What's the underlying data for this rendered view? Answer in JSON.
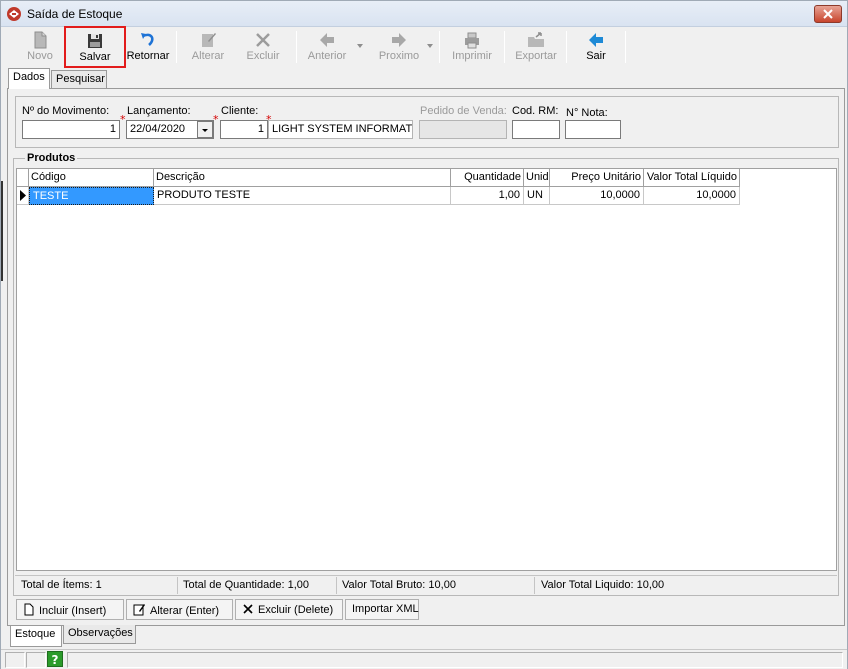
{
  "window": {
    "title": "Saída de Estoque"
  },
  "toolbar": {
    "novo": "Novo",
    "salvar": "Salvar",
    "retornar": "Retornar",
    "alterar": "Alterar",
    "excluir": "Excluir",
    "anterior": "Anterior",
    "proximo": "Proximo",
    "imprimir": "Imprimir",
    "exportar": "Exportar",
    "sair": "Sair"
  },
  "tabs_top": {
    "dados": "Dados",
    "pesquisar": "Pesquisar"
  },
  "form": {
    "movimento_label": "Nº do Movimento:",
    "movimento_value": "1",
    "lancamento_label": "Lançamento:",
    "lancamento_value": "22/04/2020",
    "cliente_label": "Cliente:",
    "cliente_code": "1",
    "cliente_name": "LIGHT SYSTEM INFORMATI",
    "pedido_label": "Pedido de Venda:",
    "pedido_value": "",
    "codrm_label": "Cod. RM:",
    "codrm_value": "",
    "nota_label": "N° Nota:",
    "nota_value": "",
    "required_mark": "*"
  },
  "products": {
    "title": "Produtos",
    "columns": {
      "codigo": "Código",
      "descricao": "Descrição",
      "quantidade": "Quantidade",
      "unidade": "Unid",
      "preco": "Preço Unitário",
      "valor": "Valor Total Líquido"
    },
    "rows": [
      {
        "codigo": "TESTE",
        "descricao": "PRODUTO TESTE",
        "quantidade": "1,00",
        "unidade": "UN",
        "preco": "10,0000",
        "valor": "10,0000"
      }
    ]
  },
  "totals": {
    "itens": "Total de Ítems: 1",
    "quantidade": "Total de Quantidade: 1,00",
    "bruto": "Valor Total Bruto: 10,00",
    "liquido": "Valor Total Liquido: 10,00"
  },
  "actions": {
    "incluir": "Incluir (Insert)",
    "alterar": "Alterar (Enter)",
    "excluir": "Excluir (Delete)",
    "importar": "Importar XML"
  },
  "tabs_bottom": {
    "estoque": "Estoque",
    "observacoes": "Observações"
  },
  "status": {
    "help": "?"
  },
  "colors": {
    "highlight": "#e21b1b",
    "selection": "#3399ff",
    "help": "#2b9b2b"
  }
}
